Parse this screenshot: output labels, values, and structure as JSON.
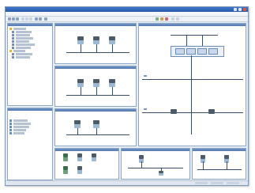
{
  "window": {
    "title": ""
  },
  "menubar": {
    "items": [
      "",
      "",
      "",
      "",
      "",
      "",
      ""
    ]
  },
  "toolbar": {
    "left_icons": [
      "new-icon",
      "open-icon",
      "save-icon",
      "cut-icon",
      "copy-icon",
      "paste-icon",
      "undo-icon",
      "redo-icon",
      "zoom-icon"
    ],
    "right_icons": [
      "network-icon",
      "settings-icon",
      "help-icon"
    ]
  },
  "tree_panel": {
    "items": [
      "",
      "",
      "",
      "",
      "",
      "",
      "",
      "",
      "",
      ""
    ]
  },
  "bottom_left_panel": {
    "items": [
      "",
      "",
      "",
      "",
      ""
    ]
  },
  "status": {
    "text": ""
  },
  "colors": {
    "titlebar": "#2a5aa8",
    "panel_header": "#5479b0",
    "bus": "#3a4d66",
    "device_top": "#4d5a68",
    "device_bottom": "#9db8d2"
  }
}
